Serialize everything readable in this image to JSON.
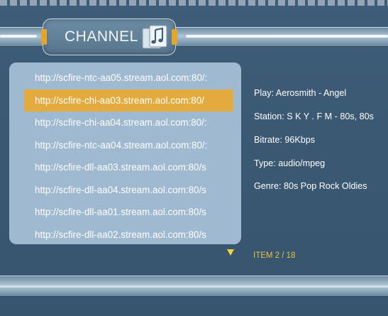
{
  "header": {
    "title": "CHANNEL",
    "icon": "music-note-icon"
  },
  "channel_list": {
    "selected_index": 1,
    "items": [
      "http://scfire-ntc-aa05.stream.aol.com:80/:",
      "http://scfire-chi-aa03.stream.aol.com:80/",
      "http://scfire-chi-aa04.stream.aol.com:80/:",
      "http://scfire-ntc-aa04.stream.aol.com:80/:",
      "http://scfire-dll-aa03.stream.aol.com:80/s",
      "http://scfire-dll-aa04.stream.aol.com:80/s",
      "http://scfire-dll-aa01.stream.aol.com:80/s",
      "http://scfire-dll-aa02.stream.aol.com:80/s"
    ]
  },
  "details": {
    "play": "Play: Aerosmith - Angel",
    "station": "Station:  S K Y . F M - 80s, 80s",
    "bitrate": "Bitrate:  96Kbps",
    "type": "Type:  audio/mpeg",
    "genre": "Genre:  80s Pop Rock Oldies"
  },
  "footer": {
    "item_counter": "ITEM 2 / 18"
  },
  "colors": {
    "background": "#3b5a74",
    "panel": "#9fb9d0",
    "highlight": "#e3ab3d",
    "counter": "#e7c23c"
  }
}
